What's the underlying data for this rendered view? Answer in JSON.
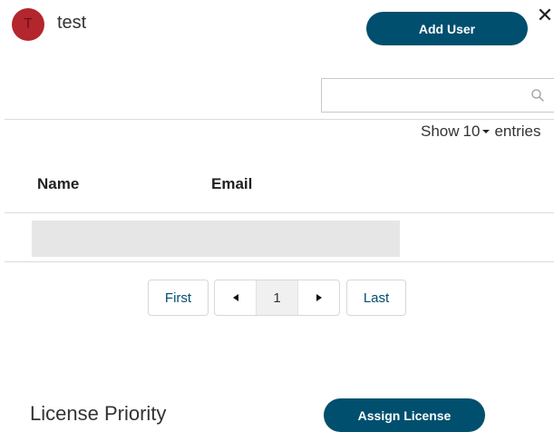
{
  "header": {
    "avatar_letter": "T",
    "group_name": "test",
    "add_user_label": "Add User",
    "close_label": "✕"
  },
  "search": {
    "value": "",
    "placeholder": ""
  },
  "entries": {
    "show_label": "Show",
    "page_size": "10",
    "entries_label": "entries"
  },
  "table": {
    "columns": [
      "Name",
      "Email"
    ],
    "rows": []
  },
  "pagination": {
    "first_label": "First",
    "current_page": "1",
    "last_label": "Last"
  },
  "license": {
    "title": "License Priority",
    "assign_label": "Assign License"
  },
  "colors": {
    "brand": "#004f6e",
    "avatar": "#b3262d",
    "placeholder_row": "#e6e6e6"
  },
  "icons": [
    "close-icon",
    "search-icon",
    "caret-down-icon",
    "chevron-left-icon",
    "chevron-right-icon"
  ]
}
